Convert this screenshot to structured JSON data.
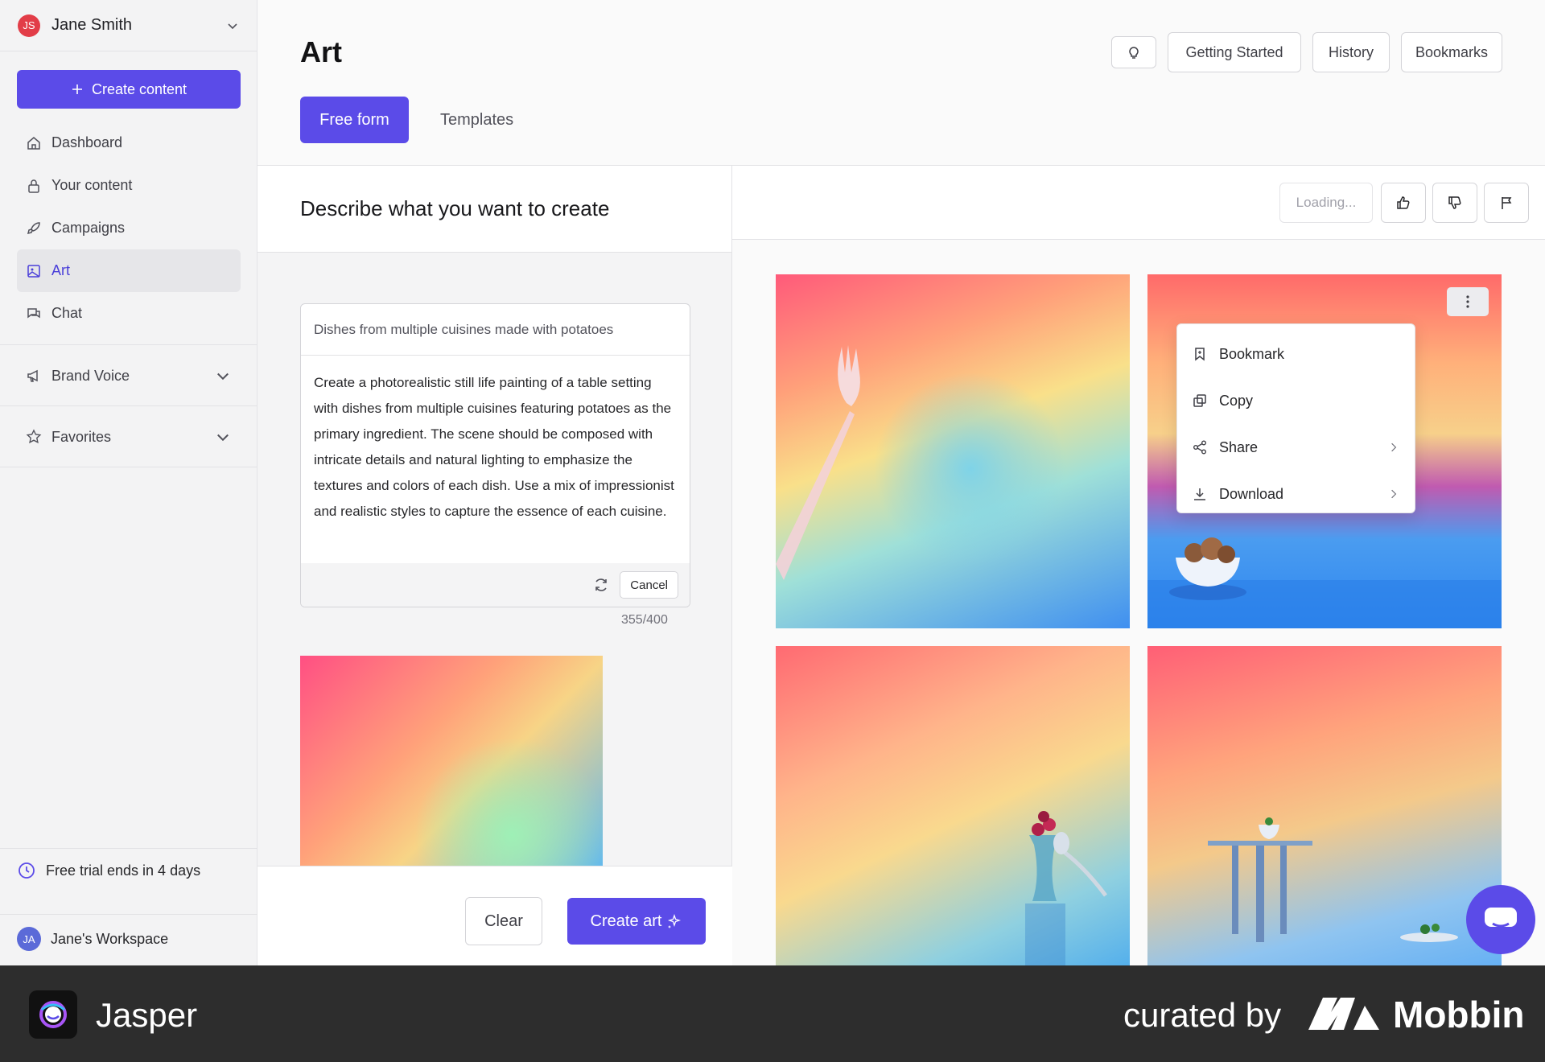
{
  "user": {
    "initials": "JS",
    "name": "Jane Smith"
  },
  "sidebar": {
    "create_label": "Create content",
    "nav": [
      {
        "label": "Dashboard",
        "icon": "home-icon"
      },
      {
        "label": "Your content",
        "icon": "lock-icon"
      },
      {
        "label": "Campaigns",
        "icon": "rocket-icon"
      },
      {
        "label": "Art",
        "icon": "image-icon",
        "active": true
      },
      {
        "label": "Chat",
        "icon": "chat-icon"
      }
    ],
    "brand_voice": "Brand Voice",
    "favorites": "Favorites",
    "trial": "Free trial ends in 4 days",
    "workspace": {
      "initials": "JA",
      "name": "Jane's Workspace"
    }
  },
  "header": {
    "title": "Art",
    "buttons": {
      "getting_started": "Getting Started",
      "history": "History",
      "bookmarks": "Bookmarks"
    },
    "tabs": {
      "free_form": "Free form",
      "templates": "Templates"
    }
  },
  "editor": {
    "heading": "Describe what you want to create",
    "prompt_title": "Dishes from multiple cuisines made with potatoes",
    "prompt_text": "Create a photorealistic still life painting of a table setting with dishes from multiple cuisines featuring potatoes as the primary ingredient. The scene should be composed with intricate details and natural lighting to emphasize the textures and colors of each dish. Use a mix of impressionist and realistic styles to capture the essence of each cuisine.",
    "cancel_label": "Cancel",
    "counter": "355/400",
    "clear_label": "Clear",
    "create_art_label": "Create art"
  },
  "results": {
    "loading_label": "Loading...",
    "menu": [
      {
        "label": "Bookmark",
        "icon": "bookmark-icon",
        "submenu": false
      },
      {
        "label": "Copy",
        "icon": "copy-icon",
        "submenu": false
      },
      {
        "label": "Share",
        "icon": "share-icon",
        "submenu": true
      },
      {
        "label": "Download",
        "icon": "download-icon",
        "submenu": true
      }
    ]
  },
  "banner": {
    "app_name": "Jasper",
    "curated_by": "curated by",
    "brand": "Mobbin"
  },
  "colors": {
    "accent": "#5b4be8",
    "avatar_red": "#e23d48",
    "banner_bg": "#2d2d2d"
  }
}
